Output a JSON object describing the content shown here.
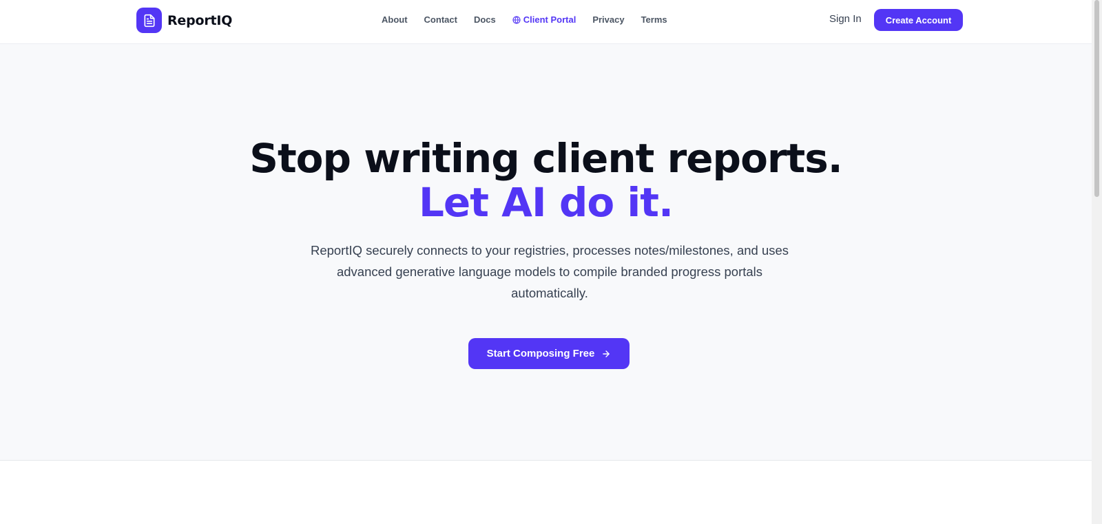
{
  "brand": {
    "name": "ReportIQ",
    "icon": "document-icon",
    "color": "#5336f5"
  },
  "nav": {
    "links": [
      {
        "label": "About"
      },
      {
        "label": "Contact"
      },
      {
        "label": "Docs"
      },
      {
        "label": "Client Portal",
        "icon": "globe-icon",
        "active": true
      },
      {
        "label": "Privacy"
      },
      {
        "label": "Terms"
      }
    ],
    "sign_in": "Sign In",
    "create_account": "Create Account"
  },
  "hero": {
    "title_line1": "Stop writing client reports.",
    "title_line2": "Let AI do it.",
    "description": "ReportIQ securely connects to your registries, processes notes/milestones, and uses advanced generative language models to compile branded progress portals automatically.",
    "cta_label": "Start Composing Free",
    "cta_icon": "arrow-right-icon"
  },
  "colors": {
    "accent": "#5336f5",
    "hero_bg": "#f8f9fb",
    "heading": "#0b0f1a"
  }
}
